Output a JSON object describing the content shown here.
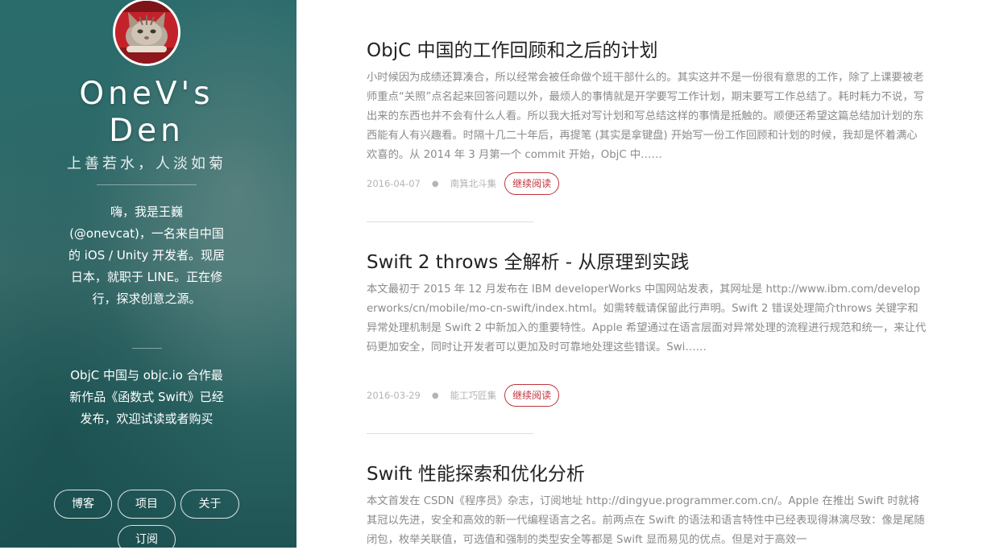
{
  "sidebar": {
    "title_line1": "OneV's",
    "title_line2": "Den",
    "tagline": "上善若水，人淡如菊",
    "bio": "嗨，我是王巍 (@onevcat)，一名来自中国的 iOS / Unity 开发者。现居日本，就职于 LINE。正在修行，探求创意之源。",
    "promo": "ObjC 中国与 objc.io 合作最新作品《函数式 Swift》已经发布，欢迎试读或者购买",
    "nav": {
      "blog": "博客",
      "projects": "项目",
      "about": "关于",
      "subscribe": "订阅"
    }
  },
  "posts": [
    {
      "title": "ObjC 中国的工作回顾和之后的计划",
      "excerpt": "小时候因为成绩还算凑合，所以经常会被任命做个班干部什么的。其实这并不是一份很有意思的工作，除了上课要被老师重点“关照”点名起来回答问题以外，最烦人的事情就是开学要写工作计划，期末要写工作总结了。耗时耗力不说，写出来的东西也并不会有什么人看。所以我大抵对写计划和写总结这样的事情是抵触的。顺便还希望这篇总结加计划的东西能有人有兴趣看。时隔十几二十年后，再提笔 (其实是拿键盘) 开始写一份工作回顾和计划的时候，我却是怀着满心欢喜的。从 2014 年 3 月第一个 commit 开始，ObjC 中……",
      "date": "2016-04-07",
      "category": "南箕北斗集",
      "read_more": "继续阅读"
    },
    {
      "title": "Swift 2 throws 全解析 - 从原理到实践",
      "excerpt": "本文最初于 2015 年 12 月发布在 IBM developerWorks 中国网站发表，其网址是 http://www.ibm.com/developerworks/cn/mobile/mo-cn-swift/index.html。如需转载请保留此行声明。Swift 2 错误处理简介throws 关键字和异常处理机制是 Swift 2 中新加入的重要特性。Apple 希望通过在语言层面对异常处理的流程进行规范和统一，来让代码更加安全，同时让开发者可以更加及时可靠地处理这些错误。Swi……",
      "date": "2016-03-29",
      "category": "能工巧匠集",
      "read_more": "继续阅读"
    },
    {
      "title": "Swift 性能探索和优化分析",
      "excerpt": "本文首发在 CSDN《程序员》杂志，订阅地址 http://dingyue.programmer.com.cn/。Apple 在推出 Swift 时就将其冠以先进，安全和高效的新一代编程语言之名。前两点在 Swift 的语法和语言特性中已经表现得淋漓尽致：像是尾随闭包，枚举关联值，可选值和强制的类型安全等都是 Swift 显而易见的优点。但是对于高效一"
    }
  ]
}
